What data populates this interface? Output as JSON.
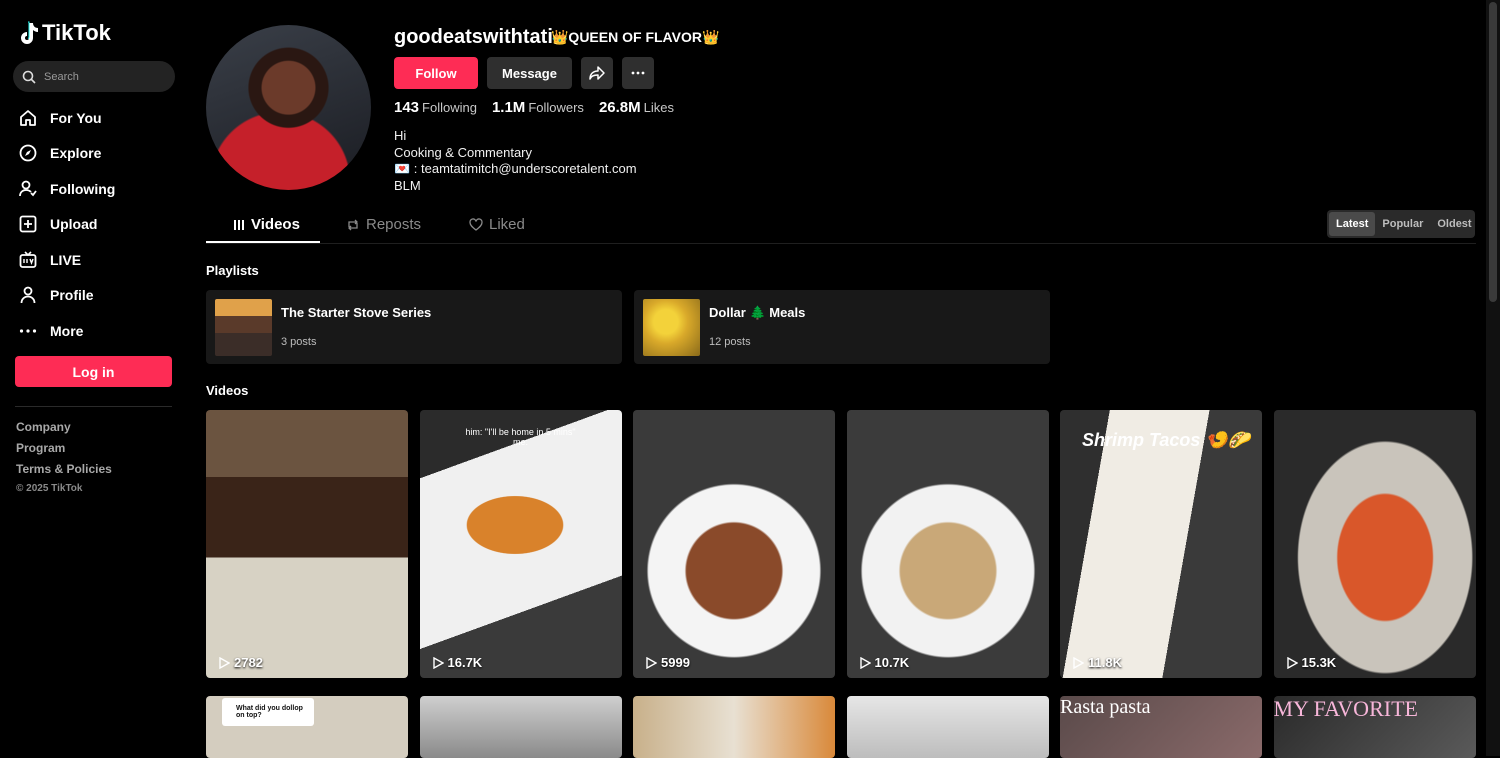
{
  "app": {
    "name": "TikTok"
  },
  "search": {
    "placeholder": "Search"
  },
  "nav": {
    "items": [
      {
        "label": "For You",
        "icon": "home-icon"
      },
      {
        "label": "Explore",
        "icon": "compass-icon"
      },
      {
        "label": "Following",
        "icon": "user-follow-icon"
      },
      {
        "label": "Upload",
        "icon": "plus-square-icon"
      },
      {
        "label": "LIVE",
        "icon": "tv-icon"
      },
      {
        "label": "Profile",
        "icon": "person-icon"
      },
      {
        "label": "More",
        "icon": "ellipsis-icon"
      }
    ],
    "login_label": "Log in"
  },
  "footer": {
    "links": [
      "Company",
      "Program",
      "Terms & Policies"
    ],
    "copyright": "© 2025 TikTok"
  },
  "profile": {
    "username": "goodeatswithtati",
    "nickname": "👑QUEEN OF FLAVOR👑",
    "follow_label": "Follow",
    "message_label": "Message",
    "stats": {
      "following_count": "143",
      "following_label": "Following",
      "followers_count": "1.1M",
      "followers_label": "Followers",
      "likes_count": "26.8M",
      "likes_label": "Likes"
    },
    "bio": [
      "Hi",
      "Cooking & Commentary",
      "💌 : teamtatimitch@underscoretalent.com",
      "BLM"
    ]
  },
  "tabs": [
    {
      "label": "Videos",
      "active": true
    },
    {
      "label": "Reposts",
      "active": false
    },
    {
      "label": "Liked",
      "active": false
    }
  ],
  "sort": {
    "options": [
      "Latest",
      "Popular",
      "Oldest"
    ],
    "selected": "Latest"
  },
  "playlists": {
    "title": "Playlists",
    "items": [
      {
        "name": "The Starter Stove Series",
        "count": "3 posts"
      },
      {
        "name": "Dollar 🌲 Meals",
        "count": "12 posts"
      }
    ]
  },
  "videos": {
    "title": "Videos",
    "items": [
      {
        "views": "2782"
      },
      {
        "views": "16.7K",
        "caption": "him: \"I'll be home in 5 mins\"\nme:"
      },
      {
        "views": "5999"
      },
      {
        "views": "10.7K"
      },
      {
        "views": "11.8K",
        "caption": "Shrimp Tacos 🍤🌮"
      },
      {
        "views": "15.3K"
      }
    ],
    "row2_captions": [
      "What did you dollop on top?",
      "",
      "",
      "",
      "Rasta pasta",
      "MY FAVORITE"
    ]
  },
  "colors": {
    "accent": "#fe2c55",
    "background": "#000000",
    "surface": "#181818"
  }
}
